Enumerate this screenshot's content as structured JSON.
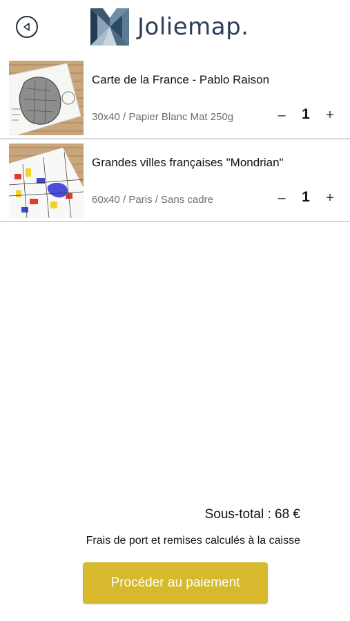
{
  "header": {
    "brand": "Joliemap.",
    "back_icon": "back-arrow-circle-icon",
    "logo_icon": "joliemap-logo-icon"
  },
  "cart": {
    "items": [
      {
        "title": "Carte de la France - Pablo Raison",
        "options": "30x40 / Papier Blanc Mat 250g",
        "quantity": "1",
        "minus_label": "–",
        "plus_label": "+"
      },
      {
        "title": "Grandes villes françaises \"Mondrian\"",
        "options": "60x40 / Paris / Sans cadre",
        "quantity": "1",
        "minus_label": "–",
        "plus_label": "+"
      }
    ]
  },
  "summary": {
    "subtotal": "Sous-total : 68 €",
    "shipping_note": "Frais de port et remises calculés à la caisse",
    "checkout_label": "Procéder au paiement"
  },
  "colors": {
    "accent": "#d6b92d",
    "brand": "#2c3e57",
    "divider": "#d8d8d8"
  }
}
